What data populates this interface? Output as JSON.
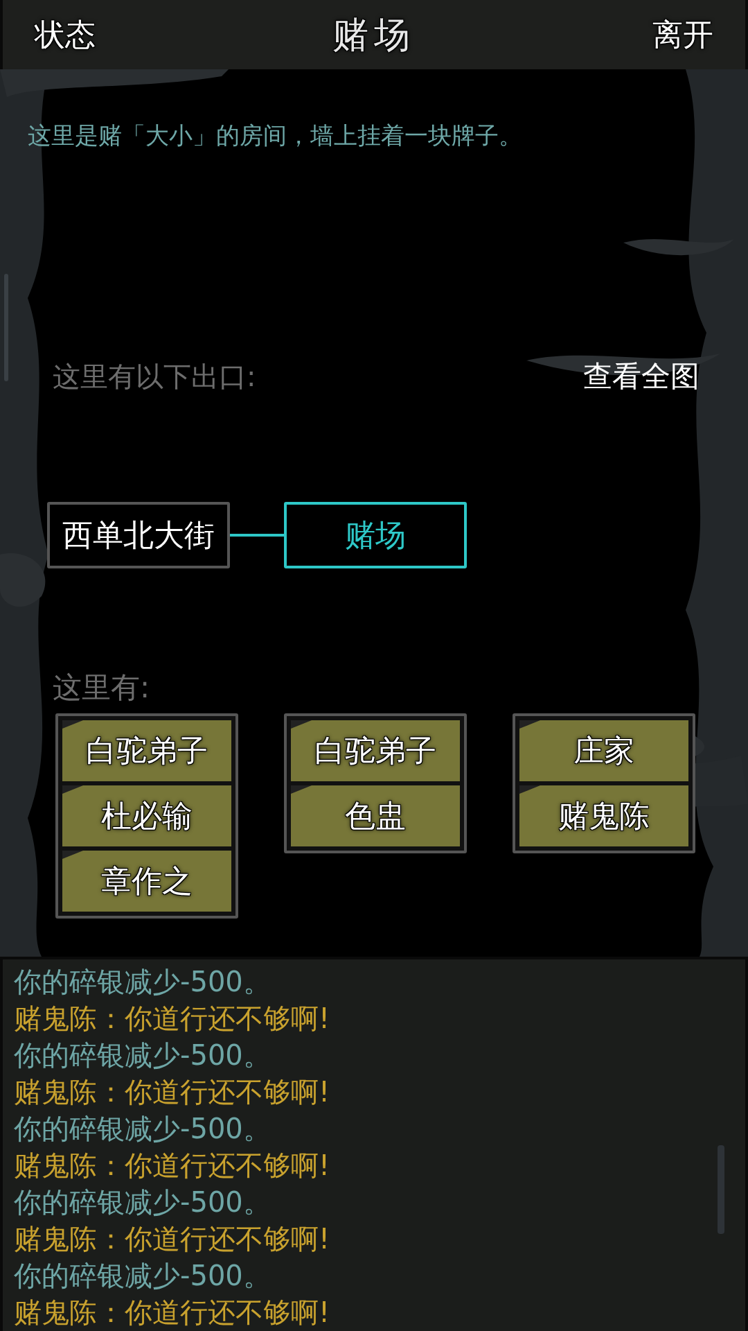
{
  "top_bar": {
    "left_button": "状态",
    "title": "赌场",
    "right_button": "离开"
  },
  "room": {
    "description": "这里是赌「大小」的房间，墙上挂着一块牌子。",
    "exits_label": "这里有以下出口:",
    "map_link": "查看全图"
  },
  "map": {
    "nodes": [
      {
        "label": "西单北大街",
        "selected": false
      },
      {
        "label": "赌场",
        "selected": true
      }
    ]
  },
  "people": {
    "label": "这里有:",
    "columns": [
      {
        "items": [
          "白驼弟子",
          "杜必输",
          "章作之"
        ]
      },
      {
        "items": [
          "白驼弟子",
          "色盅"
        ]
      },
      {
        "items": [
          "庄家",
          "赌鬼陈"
        ]
      }
    ]
  },
  "log": [
    {
      "kind": "system",
      "text": "你的碎银减少-500。"
    },
    {
      "kind": "speech",
      "text": "赌鬼陈：你道行还不够啊!"
    },
    {
      "kind": "system",
      "text": "你的碎银减少-500。"
    },
    {
      "kind": "speech",
      "text": "赌鬼陈：你道行还不够啊!"
    },
    {
      "kind": "system",
      "text": "你的碎银减少-500。"
    },
    {
      "kind": "speech",
      "text": "赌鬼陈：你道行还不够啊!"
    },
    {
      "kind": "system",
      "text": "你的碎银减少-500。"
    },
    {
      "kind": "speech",
      "text": "赌鬼陈：你道行还不够啊!"
    },
    {
      "kind": "system",
      "text": "你的碎银减少-500。"
    },
    {
      "kind": "speech",
      "text": "赌鬼陈：你道行还不够啊!"
    }
  ]
}
